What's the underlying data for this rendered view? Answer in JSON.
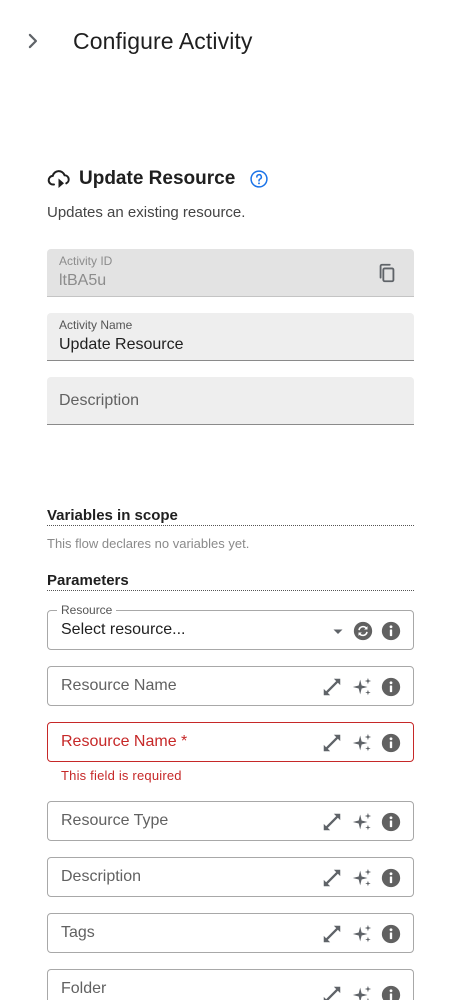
{
  "header": {
    "title": "Configure Activity",
    "collapse_icon": "chevron-right-icon"
  },
  "activity": {
    "icon": "cloud-sync-icon",
    "title": "Update Resource",
    "help_icon": "help-circle-icon",
    "description": "Updates an existing resource."
  },
  "fields": {
    "activity_id": {
      "label": "Activity ID",
      "value": "ltBA5u"
    },
    "activity_name": {
      "label": "Activity Name",
      "value": "Update Resource"
    },
    "description": {
      "placeholder": "Description"
    }
  },
  "variables": {
    "title": "Variables in scope",
    "note": "This flow declares no variables yet."
  },
  "parameters": {
    "title": "Parameters",
    "resource": {
      "label": "Resource",
      "value": "Select resource..."
    },
    "inputs": [
      {
        "placeholder": "Resource Name"
      },
      {
        "placeholder": "Resource Name *",
        "error": "This field is required"
      },
      {
        "placeholder": "Resource Type"
      },
      {
        "placeholder": "Description"
      },
      {
        "placeholder": "Tags"
      },
      {
        "placeholder": "Folder"
      }
    ]
  },
  "colors": {
    "error": "#c62828",
    "accent": "#1a73e8",
    "icon_gray": "#5f6368"
  }
}
